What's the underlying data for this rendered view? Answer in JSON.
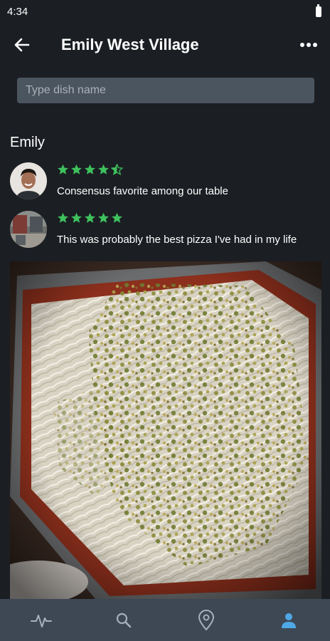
{
  "status_bar": {
    "time": "4:34"
  },
  "header": {
    "title": "Emily West Village"
  },
  "search": {
    "placeholder": "Type dish name",
    "value": ""
  },
  "section": {
    "title": "Emily"
  },
  "reviews": [
    {
      "rating": 4.5,
      "text": "Consensus favorite among our table"
    },
    {
      "rating": 5,
      "text": "This was probably the best pizza I've had in my life"
    }
  ],
  "colors": {
    "star": "#3ec15d",
    "nav_active": "#4fa8e6",
    "nav_inactive": "#a7b0ba"
  },
  "bottom_nav": {
    "items": [
      {
        "icon": "activity-icon",
        "active": false
      },
      {
        "icon": "search-icon",
        "active": false
      },
      {
        "icon": "location-pin-icon",
        "active": false
      },
      {
        "icon": "profile-icon",
        "active": true
      }
    ]
  }
}
